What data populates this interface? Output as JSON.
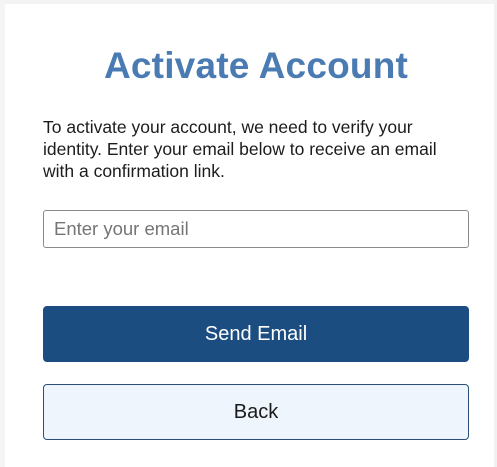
{
  "page": {
    "title": "Activate Account",
    "instructions": "To activate your account, we need to verify your identity. Enter your email below to receive an email with a confirmation link."
  },
  "form": {
    "email": {
      "value": "",
      "placeholder": "Enter your email"
    },
    "send_label": "Send Email",
    "back_label": "Back"
  },
  "colors": {
    "title": "#4a7bb2",
    "primary_button": "#1c4d80",
    "secondary_button_bg": "#eef5fd",
    "secondary_button_border": "#2a4f78"
  }
}
